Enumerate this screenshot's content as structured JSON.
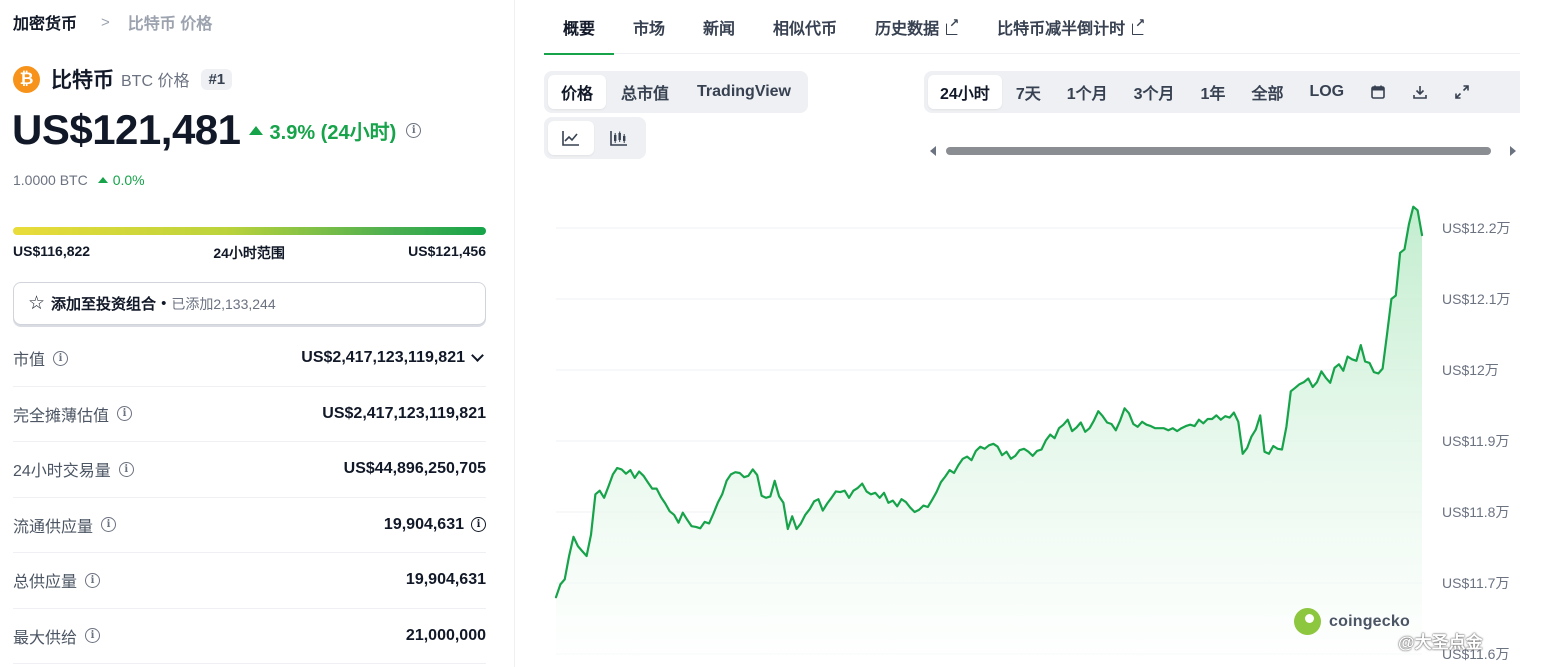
{
  "breadcrumb": {
    "home": "加密货币",
    "separator": ">",
    "current": "比特币 价格"
  },
  "coin": {
    "logo_symbol": "₿",
    "name": "比特币",
    "subtitle": "BTC 价格",
    "rank": "#1",
    "logo_color": "#f7931a"
  },
  "price": {
    "value": "US$121,481",
    "change": "3.9% (24小时)",
    "btc_value": "1.0000 BTC",
    "btc_change": "0.0%"
  },
  "range": {
    "low": "US$116,822",
    "label": "24小时范围",
    "high": "US$121,456"
  },
  "portfolio": {
    "label": "添加至投资组合",
    "dot": "•",
    "added": "已添加2,133,244"
  },
  "stats": [
    {
      "label": "市值",
      "value": "US$2,417,123,119,821"
    },
    {
      "label": "完全摊薄估值",
      "value": "US$2,417,123,119,821"
    },
    {
      "label": "24小时交易量",
      "value": "US$44,896,250,705"
    },
    {
      "label": "流通供应量",
      "value": "19,904,631"
    },
    {
      "label": "总供应量",
      "value": "19,904,631"
    },
    {
      "label": "最大供给",
      "value": "21,000,000"
    }
  ],
  "tabs": [
    "概要",
    "市场",
    "新闻",
    "相似代币",
    "历史数据",
    "比特币减半倒计时"
  ],
  "chart_modes": [
    "价格",
    "总市值",
    "TradingView"
  ],
  "chart_types": {
    "line": "line-chart-icon",
    "candle": "candlestick-icon"
  },
  "time_ranges": [
    "24小时",
    "7天",
    "1个月",
    "3个月",
    "1年",
    "全部",
    "LOG"
  ],
  "toolbar_icons": [
    "calendar-icon",
    "download-icon",
    "fullscreen-icon"
  ],
  "watermark": {
    "brand": "coingecko",
    "overlay": "@大圣点金"
  },
  "colors": {
    "up": "#16a34a",
    "line": "#16a34a",
    "fill": "#dcf5e3"
  },
  "chart_data": {
    "type": "area",
    "title": "",
    "xlabel": "",
    "ylabel": "",
    "y_unit": "US$",
    "y_ticks": [
      117000,
      117000,
      118000,
      119000,
      120000,
      121000,
      122000
    ],
    "y_tick_labels": [
      "US$11.6万",
      "US$11.7万",
      "US$11.8万",
      "US$11.9万",
      "US$12万",
      "US$12.1万",
      "US$12.2万"
    ],
    "ylim": [
      116000,
      122400
    ],
    "grid": true,
    "series": [
      {
        "values": [
          116800,
          116980,
          117050,
          117380,
          117650,
          117520,
          117450,
          117380,
          117680,
          118250,
          118300,
          118200,
          118360,
          118530,
          118620,
          118600,
          118540,
          118590,
          118480,
          118570,
          118510,
          118420,
          118330,
          118330,
          118210,
          118120,
          118010,
          117960,
          117850,
          117990,
          117890,
          117800,
          117790,
          117770,
          117860,
          117840,
          117980,
          118130,
          118250,
          118440,
          118530,
          118560,
          118550,
          118490,
          118510,
          118600,
          118520,
          118230,
          118200,
          118220,
          118440,
          118220,
          118130,
          117760,
          117940,
          117760,
          117840,
          117960,
          118040,
          118150,
          118180,
          118020,
          118120,
          118200,
          118290,
          118280,
          118300,
          118200,
          118300,
          118340,
          118400,
          118290,
          118250,
          118270,
          118200,
          118270,
          118130,
          118160,
          118080,
          118180,
          118140,
          118060,
          118000,
          118030,
          118090,
          118070,
          118170,
          118280,
          118420,
          118500,
          118590,
          118550,
          118660,
          118750,
          118780,
          118730,
          118860,
          118920,
          118890,
          118940,
          118960,
          118920,
          118800,
          118850,
          118750,
          118790,
          118870,
          118890,
          118850,
          118790,
          118860,
          118880,
          119010,
          119090,
          119040,
          119180,
          119230,
          119300,
          119140,
          119190,
          119260,
          119130,
          119180,
          119290,
          119420,
          119350,
          119260,
          119240,
          119150,
          119290,
          119460,
          119390,
          119240,
          119200,
          119270,
          119230,
          119210,
          119180,
          119180,
          119180,
          119150,
          119180,
          119140,
          119180,
          119210,
          119230,
          119210,
          119300,
          119250,
          119310,
          119310,
          119360,
          119300,
          119350,
          119330,
          119400,
          119270,
          118820,
          118900,
          119060,
          119160,
          119360,
          118850,
          118820,
          118930,
          118890,
          118880,
          119200,
          119700,
          119750,
          119800,
          119830,
          119880,
          119760,
          119830,
          119980,
          119890,
          119820,
          120030,
          120080,
          119990,
          120190,
          120150,
          120130,
          120350,
          120120,
          120100,
          119970,
          119950,
          120020,
          120500,
          121000,
          121050,
          121650,
          121700,
          122050,
          122300,
          122250,
          121900
        ]
      }
    ]
  }
}
